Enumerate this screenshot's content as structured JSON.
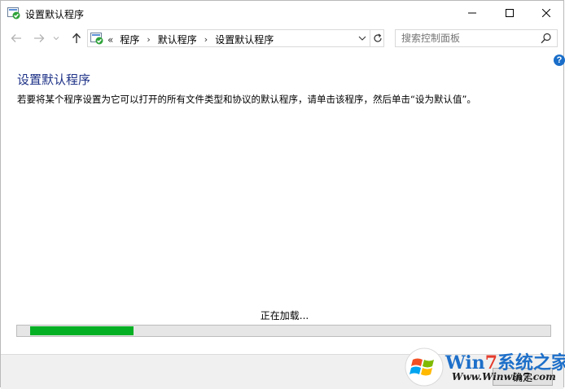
{
  "window": {
    "title": "设置默认程序"
  },
  "navbar": {
    "breadcrumb_prefix": "«",
    "breadcrumbs": [
      "程序",
      "默认程序",
      "设置默认程序"
    ],
    "search_placeholder": "搜索控制面板"
  },
  "content": {
    "title": "设置默认程序",
    "description": "若要将某个程序设置为它可以打开的所有文件类型和协议的默认程序，请单击该程序，然后单击“设为默认值”。",
    "loading_text": "正在加载...",
    "progress_percent": 20
  },
  "footer": {
    "ok_label": "确定"
  },
  "watermark": {
    "brand_win": "Win",
    "brand_seven": "7",
    "brand_rest": "系统之家",
    "url": "Www.Winwin7.com"
  },
  "colors": {
    "title_blue": "#1e3287",
    "progress_green": "#06b025",
    "help_blue": "#1a6ec9"
  }
}
